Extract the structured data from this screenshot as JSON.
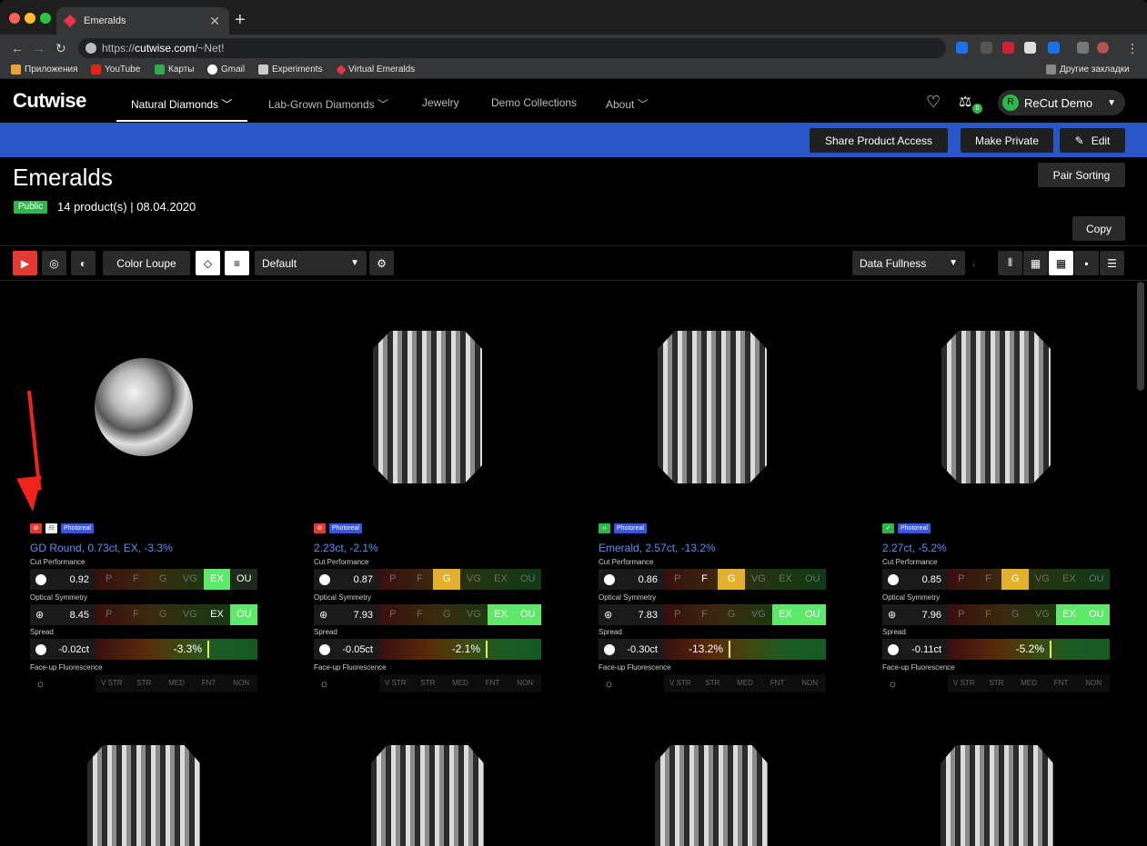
{
  "browser": {
    "tab_title": "Emeralds",
    "url_prefix": "https://",
    "url_host": "cutwise.com",
    "url_path": "/~Net!",
    "bookmarks": [
      "Приложения",
      "YouTube",
      "Карты",
      "Gmail",
      "Experiments",
      "Virtual Emeralds"
    ],
    "other_bookmarks": "Другие закладки"
  },
  "header": {
    "logo": "Cutwise",
    "nav": [
      {
        "label": "Natural Diamonds ﹀"
      },
      {
        "label": "Lab-Grown Diamonds ﹀"
      },
      {
        "label": "Jewelry"
      },
      {
        "label": "Demo Collections"
      },
      {
        "label": "About ﹀"
      }
    ],
    "user_initial": "R",
    "user_name": "ReCut Demo",
    "compare_count": "0"
  },
  "bluebar": {
    "share": "Share Product Access",
    "private": "Make Private",
    "edit": "Edit"
  },
  "collection": {
    "title": "Emeralds",
    "visibility": "Public",
    "meta": "14 product(s) | 08.04.2020",
    "pair_sorting": "Pair Sorting",
    "copy": "Copy"
  },
  "toolbar": {
    "color_loupe": "Color Loupe",
    "preset": "Default",
    "sort": "Data Fullness"
  },
  "labels": {
    "cut": "Cut Performance",
    "symmetry": "Optical Symmetry",
    "spread": "Spread",
    "fluor": "Face-up Fluorescence",
    "photoreal": "Photoreal"
  },
  "grade_scale": [
    "P",
    "F",
    "G",
    "VG",
    "EX",
    "OU"
  ],
  "fluor_scale": [
    "V STR",
    "STR",
    "MED",
    "FNT",
    "NON"
  ],
  "products": [
    {
      "name": "GD Round, 0.73ct, EX, -3.3%",
      "shape": "round",
      "cut": "0.92",
      "symmetry": "8.45",
      "spread_ct": "-0.02ct",
      "spread_pct": "-3.3%",
      "status": "red",
      "cut_grade": "EX",
      "sym_grade": "OU"
    },
    {
      "name": "2.23ct, -2.1%",
      "shape": "emerald",
      "cut": "0.87",
      "symmetry": "7.93",
      "spread_ct": "-0.05ct",
      "spread_pct": "-2.1%",
      "status": "red",
      "cut_grade": "G",
      "sym_grade": "EX"
    },
    {
      "name": "Emerald, 2.57ct, -13.2%",
      "shape": "emerald",
      "cut": "0.86",
      "symmetry": "7.83",
      "spread_ct": "-0.30ct",
      "spread_pct": "-13.2%",
      "status": "green",
      "cut_grade": "G",
      "sym_grade": "EX"
    },
    {
      "name": "2.27ct, -5.2%",
      "shape": "emerald",
      "cut": "0.85",
      "symmetry": "7.96",
      "spread_ct": "-0.11ct",
      "spread_pct": "-5.2%",
      "status": "green-check",
      "cut_grade": "G",
      "sym_grade": "EX"
    }
  ]
}
